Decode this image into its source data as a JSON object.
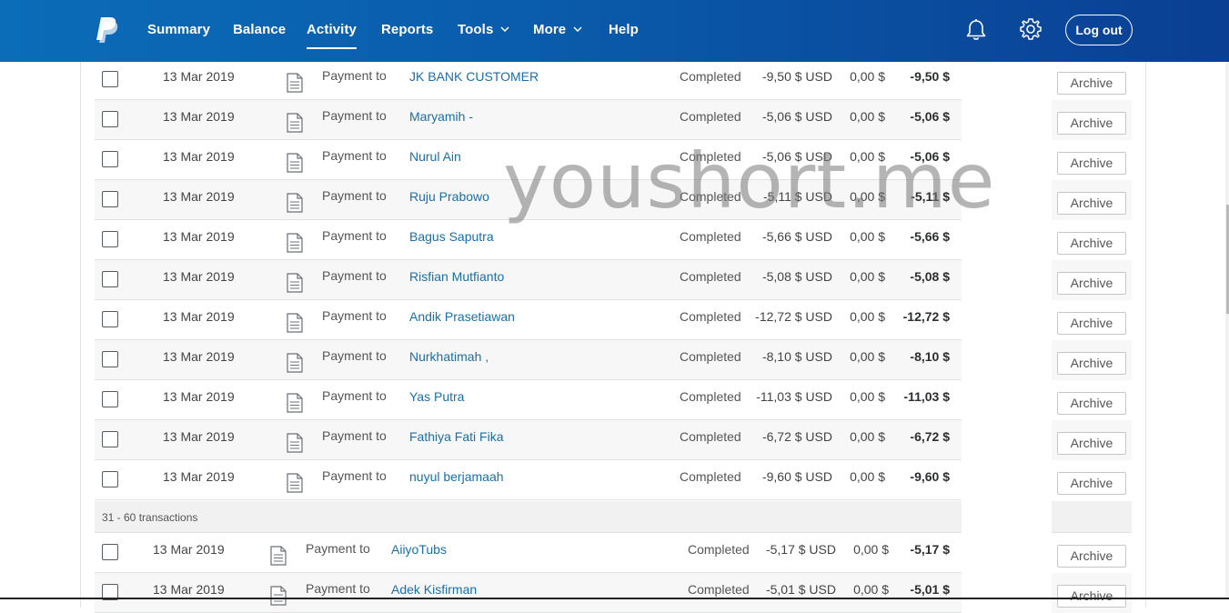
{
  "nav": {
    "items": [
      {
        "label": "Summary",
        "active": false
      },
      {
        "label": "Balance",
        "active": false
      },
      {
        "label": "Activity",
        "active": true
      },
      {
        "label": "Reports",
        "active": false
      },
      {
        "label": "Tools",
        "active": false,
        "dropdown": true
      },
      {
        "label": "More",
        "active": false,
        "dropdown": true
      },
      {
        "label": "Help",
        "active": false
      }
    ],
    "logout_label": "Log out",
    "icons": [
      "paypal-logo",
      "bell-icon",
      "gear-icon"
    ]
  },
  "transactions": [
    {
      "date": "13 Mar 2019",
      "type": "Payment to",
      "name": "JK BANK CUSTOMER",
      "status": "Completed",
      "gross": "-9,50 $ USD",
      "fee": "0,00 $",
      "net": "-9,50 $",
      "action": "Archive"
    },
    {
      "date": "13 Mar 2019",
      "type": "Payment to",
      "name": "Maryamih -",
      "status": "Completed",
      "gross": "-5,06 $ USD",
      "fee": "0,00 $",
      "net": "-5,06 $",
      "action": "Archive"
    },
    {
      "date": "13 Mar 2019",
      "type": "Payment to",
      "name": "Nurul Ain",
      "status": "Completed",
      "gross": "-5,06 $ USD",
      "fee": "0,00 $",
      "net": "-5,06 $",
      "action": "Archive"
    },
    {
      "date": "13 Mar 2019",
      "type": "Payment to",
      "name": "Ruju Prabowo",
      "status": "Completed",
      "gross": "-5,11 $ USD",
      "fee": "0,00 $",
      "net": "-5,11 $",
      "action": "Archive"
    },
    {
      "date": "13 Mar 2019",
      "type": "Payment to",
      "name": "Bagus Saputra",
      "status": "Completed",
      "gross": "-5,66 $ USD",
      "fee": "0,00 $",
      "net": "-5,66 $",
      "action": "Archive"
    },
    {
      "date": "13 Mar 2019",
      "type": "Payment to",
      "name": "Risfian Mutfianto",
      "status": "Completed",
      "gross": "-5,08 $ USD",
      "fee": "0,00 $",
      "net": "-5,08 $",
      "action": "Archive"
    },
    {
      "date": "13 Mar 2019",
      "type": "Payment to",
      "name": "Andik Prasetiawan",
      "status": "Completed",
      "gross": "-12,72 $ USD",
      "fee": "0,00 $",
      "net": "-12,72 $",
      "action": "Archive"
    },
    {
      "date": "13 Mar 2019",
      "type": "Payment to",
      "name": "Nurkhatimah ,",
      "status": "Completed",
      "gross": "-8,10 $ USD",
      "fee": "0,00 $",
      "net": "-8,10 $",
      "action": "Archive"
    },
    {
      "date": "13 Mar 2019",
      "type": "Payment to",
      "name": "Yas Putra",
      "status": "Completed",
      "gross": "-11,03 $ USD",
      "fee": "0,00 $",
      "net": "-11,03 $",
      "action": "Archive"
    },
    {
      "date": "13 Mar 2019",
      "type": "Payment to",
      "name": "Fathiya Fati Fika",
      "status": "Completed",
      "gross": "-6,72 $ USD",
      "fee": "0,00 $",
      "net": "-6,72 $",
      "action": "Archive"
    },
    {
      "date": "13 Mar 2019",
      "type": "Payment to",
      "name": "nuyul berjamaah",
      "status": "Completed",
      "gross": "-9,60 $ USD",
      "fee": "0,00 $",
      "net": "-9,60 $",
      "action": "Archive"
    }
  ],
  "section": {
    "label": "31 - 60 transactions"
  },
  "transactions2": [
    {
      "date": "13 Mar 2019",
      "type": "Payment to",
      "name": "AiiyoTubs",
      "status": "Completed",
      "gross": "-5,17 $ USD",
      "fee": "0,00 $",
      "net": "-5,17 $",
      "action": "Archive"
    },
    {
      "date": "13 Mar 2019",
      "type": "Payment to",
      "name": "Adek Kisfirman",
      "status": "Completed",
      "gross": "-5,01 $ USD",
      "fee": "0,00 $",
      "net": "-5,01 $",
      "action": "Archive"
    }
  ],
  "watermark": "youshort.me",
  "colors": {
    "header_start": "#0b6cb8",
    "header_end": "#0a3f93",
    "link": "#1a6eaa"
  }
}
